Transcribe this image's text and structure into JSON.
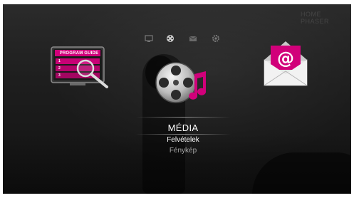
{
  "brand": {
    "text": "HOME PHASER"
  },
  "topbar": {
    "icons": [
      "tv-icon",
      "film-reel-icon",
      "mail-icon",
      "gear-icon"
    ]
  },
  "program_guide": {
    "title": "PROGRAM GUIDE",
    "rows": [
      "1",
      "2",
      "3"
    ]
  },
  "menu": {
    "title": "MÉDIA",
    "items": [
      "Felvételek",
      "Fénykép"
    ]
  },
  "colors": {
    "accent": "#d1007a",
    "accent_light": "#ff5fb4",
    "background": "#1e1e1e",
    "text_primary": "#ffffff",
    "text_secondary": "#a8a8a8"
  }
}
